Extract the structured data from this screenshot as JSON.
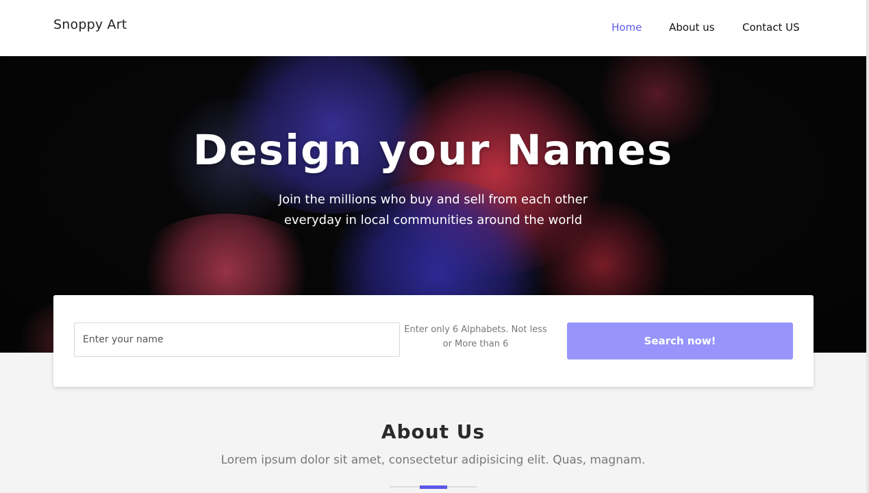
{
  "brand": "Snoppy Art",
  "nav": {
    "items": [
      {
        "label": "Home",
        "active": true
      },
      {
        "label": "About us",
        "active": false
      },
      {
        "label": "Contact US",
        "active": false
      }
    ]
  },
  "hero": {
    "title": "Design your Names",
    "subtitle_lines": [
      "Join the millions who buy and sell from each other",
      "everyday in local communities around the world"
    ]
  },
  "search": {
    "placeholder": "Enter your name",
    "value": "",
    "hint": "Enter only 6 Alphabets. Not less or More than 6",
    "button_label": "Search now!"
  },
  "about": {
    "title": "About Us",
    "text": "Lorem ipsum dolor sit amet, consectetur adipisicing elit. Quas, magnam."
  },
  "colors": {
    "accent": "#5b57e6",
    "button": "#9795fb",
    "page_background": "#f4f4f4"
  }
}
